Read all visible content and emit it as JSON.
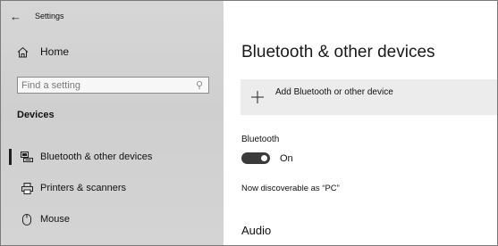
{
  "window": {
    "title": "Settings"
  },
  "sidebar": {
    "home_label": "Home",
    "search_placeholder": "Find a setting",
    "section_header": "Devices",
    "items": [
      {
        "label": "Bluetooth & other devices",
        "icon": "keyboard-device-icon",
        "selected": true
      },
      {
        "label": "Printers & scanners",
        "icon": "printer-icon",
        "selected": false
      },
      {
        "label": "Mouse",
        "icon": "mouse-icon",
        "selected": false
      }
    ]
  },
  "main": {
    "title": "Bluetooth & other devices",
    "add_button_label": "Add Bluetooth or other device",
    "bluetooth_label": "Bluetooth",
    "toggle_state": "On",
    "discoverable_text": "Now discoverable as “PC”",
    "audio_heading": "Audio"
  },
  "colors": {
    "sidebar_bg": "#d2d2d2",
    "toggle_on": "#3a3a3a",
    "add_button_bg": "#ececec"
  }
}
